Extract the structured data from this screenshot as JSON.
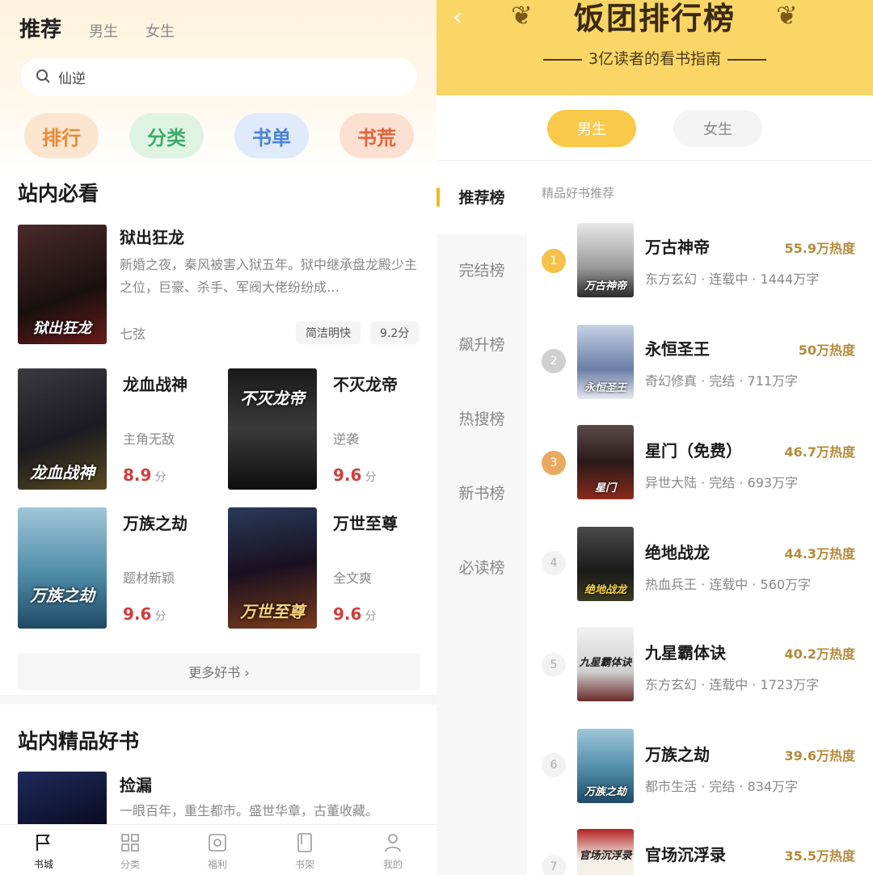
{
  "left": {
    "tabs": [
      "推荐",
      "男生",
      "女生"
    ],
    "search": {
      "value": "仙逆"
    },
    "quick": [
      "排行",
      "分类",
      "书单",
      "书荒"
    ],
    "section1": {
      "title": "站内必看",
      "featured": {
        "title": "狱出狂龙",
        "desc": "新婚之夜，秦风被害入狱五年。狱中继承盘龙殿少主之位，巨豪、杀手、军阀大佬纷纷成…",
        "author": "七弦",
        "tag": "简洁明快",
        "score": "9.2分",
        "cover_text": "狱出狂龙"
      },
      "grid": [
        {
          "title": "龙血战神",
          "tag": "主角无敌",
          "score": "8.9",
          "unit": "分",
          "cover_text": "龙血战神"
        },
        {
          "title": "不灭龙帝",
          "tag": "逆袭",
          "score": "9.6",
          "unit": "分",
          "cover_text": "不灭龙帝"
        },
        {
          "title": "万族之劫",
          "tag": "题材新颖",
          "score": "9.6",
          "unit": "分",
          "cover_text": "万族之劫"
        },
        {
          "title": "万世至尊",
          "tag": "全文爽",
          "score": "9.6",
          "unit": "分",
          "cover_text": "万世至尊"
        }
      ],
      "more": "更多好书 ›"
    },
    "section2": {
      "title": "站内精品好书",
      "book": {
        "title": "捡漏",
        "desc": "一眼百年，重生都市。盛世华章，古董收藏。"
      }
    },
    "nav": [
      "书城",
      "分类",
      "福利",
      "书架",
      "我的"
    ]
  },
  "right": {
    "title": "饭团排行榜",
    "subtitle": "3亿读者的看书指南",
    "gender_tabs": [
      "男生",
      "女生"
    ],
    "side": [
      "推荐榜",
      "完结榜",
      "飙升榜",
      "热搜榜",
      "新书榜",
      "必读榜"
    ],
    "section": "精品好书推荐",
    "books": [
      {
        "rank": "1",
        "title": "万古神帝",
        "heat": "55.9万热度",
        "meta": "东方玄幻 · 连载中 · 1444万字",
        "cover_text": "万古神帝"
      },
      {
        "rank": "2",
        "title": "永恒圣王",
        "heat": "50万热度",
        "meta": "奇幻修真 · 完结 · 711万字",
        "cover_text": "永恒圣王"
      },
      {
        "rank": "3",
        "title": "星门（免费）",
        "heat": "46.7万热度",
        "meta": "异世大陆 · 完结 · 693万字",
        "cover_text": "星门"
      },
      {
        "rank": "4",
        "title": "绝地战龙",
        "heat": "44.3万热度",
        "meta": "热血兵王 · 连载中 · 560万字",
        "cover_text": "绝地战龙"
      },
      {
        "rank": "5",
        "title": "九星霸体诀",
        "heat": "40.2万热度",
        "meta": "东方玄幻 · 连载中 · 1723万字",
        "cover_text": "九星霸体诀"
      },
      {
        "rank": "6",
        "title": "万族之劫",
        "heat": "39.6万热度",
        "meta": "都市生活 · 完结 · 834万字",
        "cover_text": "万族之劫"
      },
      {
        "rank": "7",
        "title": "官场沉浮录",
        "heat": "35.5万热度",
        "meta": "",
        "cover_text": "官场沉浮录"
      }
    ]
  }
}
